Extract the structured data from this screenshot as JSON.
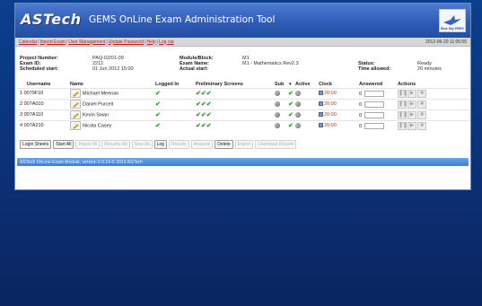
{
  "header": {
    "logo_text": "ASTech",
    "app_title": "GEMS OnLine Exam Administration Tool",
    "partner_logo_text": "Blue Sky PBEG"
  },
  "nav": {
    "links": [
      "Calendar",
      "Import Exam",
      "User Management",
      "Update Password",
      "Help",
      "Log out"
    ],
    "separator": "|",
    "timestamp": "2012-06-20 11:06:55"
  },
  "exam_info": {
    "project_number_label": "Project Number:",
    "project_number": "PAQ-02/01-09",
    "exam_id_label": "Exam ID:",
    "exam_id": "2212",
    "scheduled_start_label": "Scheduled start:",
    "scheduled_start": "01 Jun 2012 15:00",
    "module_block_label": "Module/Block:",
    "module_block": "M1",
    "exam_name_label": "Exam Name:",
    "exam_name": "M1 - Mathematics Rev2.3",
    "actual_start_label": "Actual start:",
    "actual_start": "",
    "status_label": "Status:",
    "status": "Ready",
    "time_allowed_label": "Time allowed:",
    "time_allowed": "20 minutes"
  },
  "table": {
    "headers": {
      "username": "Username",
      "name": "Name",
      "logged_in": "Logged In",
      "preliminary": "Preliminary Screens",
      "sub": "Sub",
      "sort_arrow": "▼",
      "active": "Active",
      "clock": "Clock",
      "answered": "Answered",
      "actions": "Actions"
    },
    "rows": [
      {
        "index": "1",
        "username": "0079F10",
        "name": "Michael Meenan",
        "logged_in": "✔",
        "prelim": "✔✔✔",
        "sub_check": "✔",
        "clock": "20:00",
        "answered": "0"
      },
      {
        "index": "2",
        "username": "007A010",
        "name": "Daniel Purcell",
        "logged_in": "✔",
        "prelim": "✔✔✔",
        "sub_check": "✔",
        "clock": "20:00",
        "answered": "0"
      },
      {
        "index": "3",
        "username": "007A110",
        "name": "Kevin Swan",
        "logged_in": "✔",
        "prelim": "✔✔✔",
        "sub_check": "✔",
        "clock": "20:00",
        "answered": "0"
      },
      {
        "index": "4",
        "username": "007A210",
        "name": "Nicola Casey",
        "logged_in": "✔",
        "prelim": "✔✔✔",
        "sub_check": "✔",
        "clock": "20:00",
        "answered": "0"
      }
    ],
    "action_glyphs": {
      "pause": "❚❚",
      "play": "▶",
      "stop": "■"
    }
  },
  "buttons": {
    "login_sheets": "Login Sheets",
    "start_all": "Start All",
    "pause_all": "Pause All",
    "resume_all": "Resume All",
    "stop_all": "Stop All",
    "log": "Log",
    "results": "Results",
    "analysis": "Analysis",
    "delete": "Delete",
    "export": "Export",
    "download_results": "Download Results"
  },
  "footer": {
    "text": "ASTech OnLine Exam Module, version 0.9.14  © 2012 ASTech"
  },
  "colors": {
    "banner": "#2f5cb6",
    "nav_link": "#b31c1c",
    "check": "#2e9e2e",
    "clock_value": "#c0392b",
    "footer": "#3b7dd0"
  }
}
